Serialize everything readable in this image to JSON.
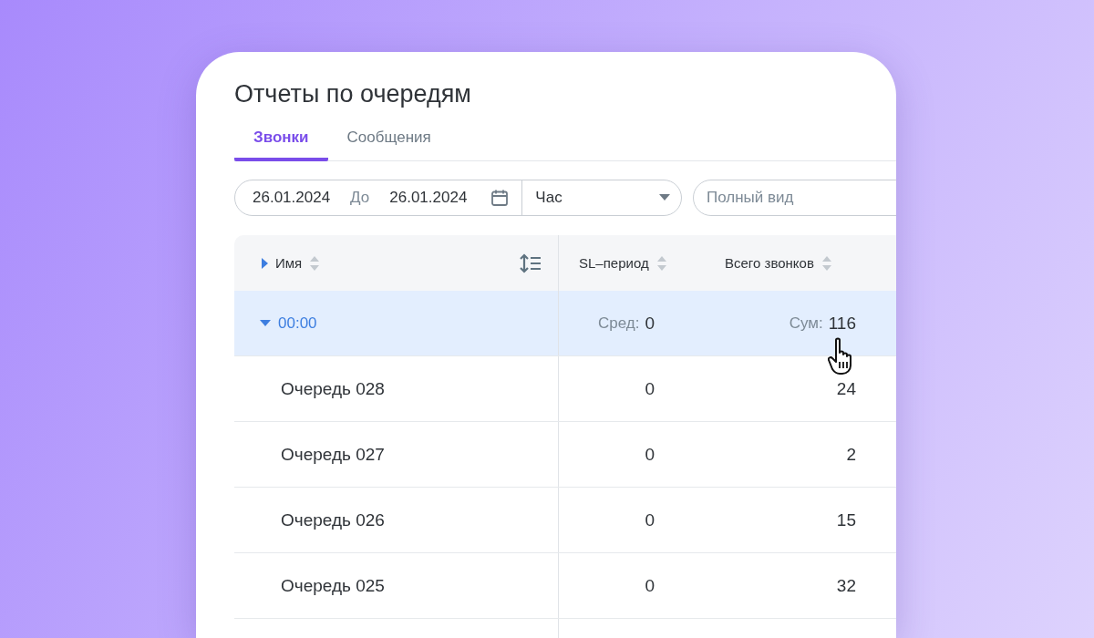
{
  "title": "Отчеты по очередям",
  "tabs": [
    {
      "label": "Звонки",
      "selected": true
    },
    {
      "label": "Сообщения",
      "selected": false
    }
  ],
  "filters": {
    "date_from": "26.01.2024",
    "separator": "До",
    "date_to": "26.01.2024",
    "interval": "Час",
    "view": {
      "placeholder": "Полный вид"
    }
  },
  "table": {
    "columns": [
      {
        "label": "Имя"
      },
      {
        "label": "SL–период"
      },
      {
        "label": "Всего звонков"
      }
    ],
    "group": {
      "label": "00:00",
      "expanded": true,
      "cells": [
        {
          "prefix": "Сред:",
          "value": "0"
        },
        {
          "prefix": "Сум:",
          "value": "116"
        }
      ]
    },
    "rows": [
      {
        "name": "Очередь 028",
        "cells": [
          "0",
          "24"
        ]
      },
      {
        "name": "Очередь 027",
        "cells": [
          "0",
          "2"
        ]
      },
      {
        "name": "Очередь 026",
        "cells": [
          "0",
          "15"
        ]
      },
      {
        "name": "Очередь 025",
        "cells": [
          "0",
          "32"
        ]
      }
    ]
  }
}
